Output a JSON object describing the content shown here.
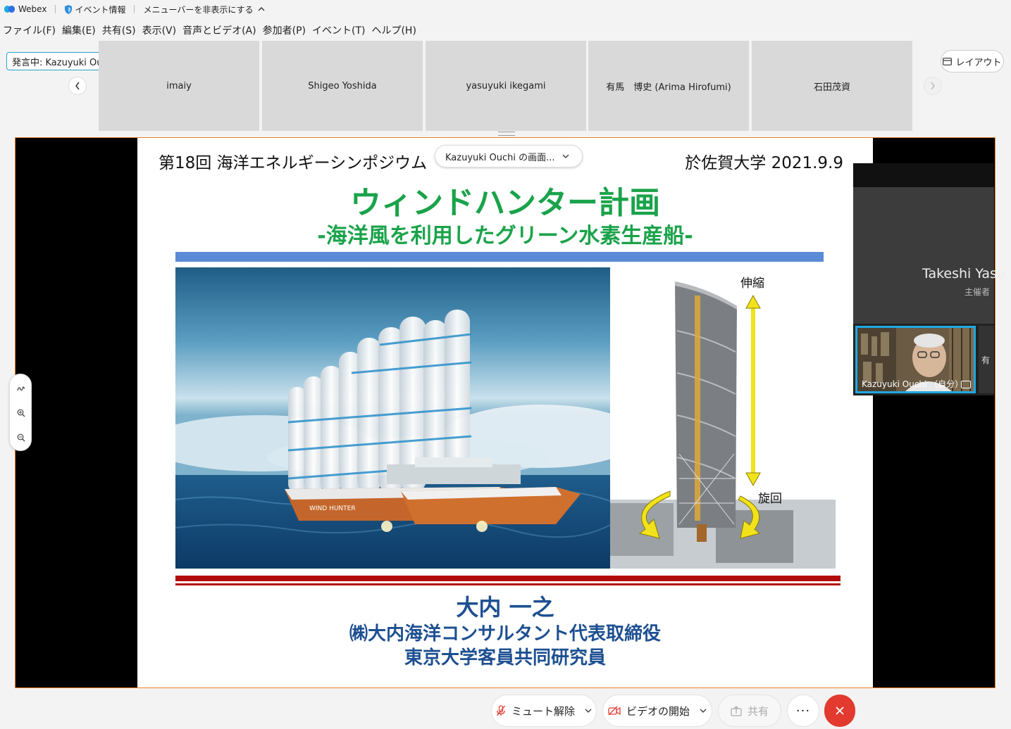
{
  "titlebar": {
    "app_name": "Webex",
    "event_info": "イベント情報",
    "hide_menu": "メニューバーを非表示にする",
    "chevron": "^"
  },
  "menu": [
    "ファイル(F)",
    "編集(E)",
    "共有(S)",
    "表示(V)",
    "音声とビデオ(A)",
    "参加者(P)",
    "イベント(T)",
    "ヘルプ(H)"
  ],
  "speaking": "発言中: Kazuyuki Ouchi",
  "participants": [
    "imaiy",
    "Shigeo Yoshida",
    "yasuyuki ikegami",
    "有馬　博史 (Arima Hirofumi)",
    "石田茂資"
  ],
  "layout_label": "レイアウト",
  "presenter_pill": "Kazuyuki Ouchi の画面...",
  "slide": {
    "head_left": "第18回 海洋エネルギーシンポジウム",
    "head_right": "於佐賀大学 2021.9.9",
    "title": "ウィンドハンター計画",
    "subtitle": "-海洋風を利用したグリーン水素生産船-",
    "label_extend": "伸縮",
    "label_rotate": "旋回",
    "ship_name": "WIND HUNTER",
    "author": "大内 一之",
    "affiliation1": "㈱大内海洋コンサルタント代表取締役",
    "affiliation2": "東京大学客員共同研究員"
  },
  "video": {
    "host_name": "Takeshi Yasu",
    "host_role": "主催者",
    "self_label": "Kazuyuki Ouchi （自分）",
    "other_initial": "有"
  },
  "controls": {
    "mute": "ミュート解除",
    "video": "ビデオの開始",
    "share": "共有",
    "more": "···"
  },
  "colors": {
    "accent": "#23a1c7",
    "share_border": "#e8802c",
    "title_green": "#1aa34a",
    "author_blue": "#1d4f91",
    "end_red": "#e23a2e"
  }
}
